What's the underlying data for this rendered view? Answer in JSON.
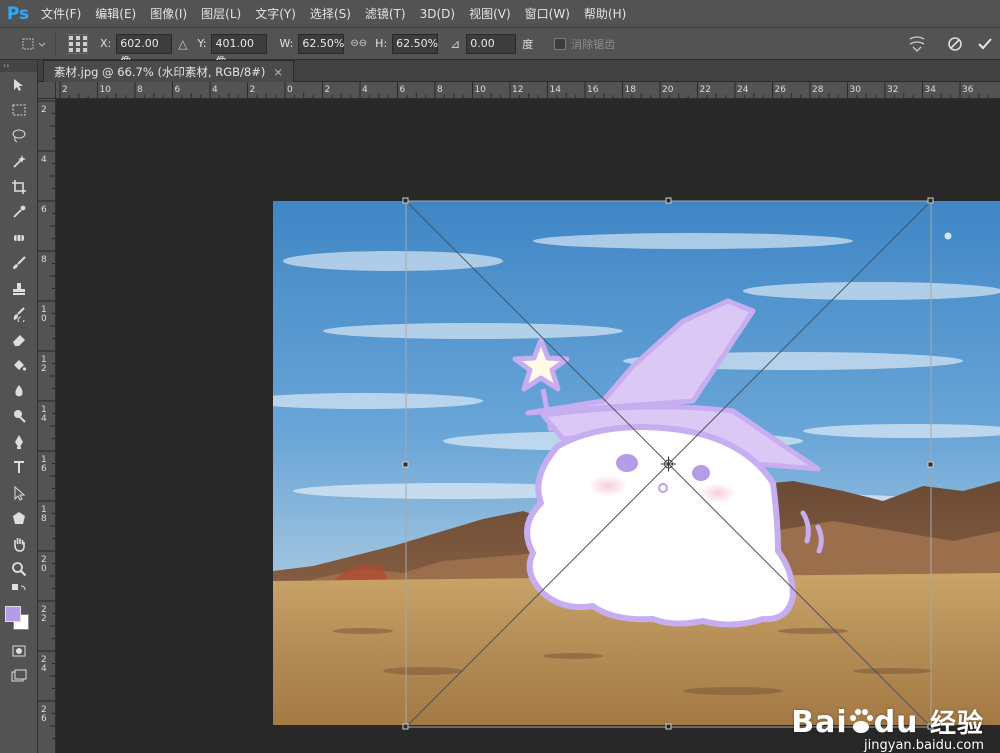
{
  "app": {
    "logo": "Ps",
    "menu": [
      "文件(F)",
      "编辑(E)",
      "图像(I)",
      "图层(L)",
      "文字(Y)",
      "选择(S)",
      "滤镜(T)",
      "3D(D)",
      "视图(V)",
      "窗口(W)",
      "帮助(H)"
    ]
  },
  "options": {
    "x_label": "X:",
    "x_value": "602.00 像",
    "y_label": "Y:",
    "y_value": "401.00 像",
    "w_label": "W:",
    "w_value": "62.50%",
    "h_label": "H:",
    "h_value": "62.50%",
    "angle_value": "0.00",
    "angle_unit": "度",
    "antialias_label": "消除锯齿",
    "delta_symbol": "△",
    "link_symbol": "⊖⊖",
    "angle_symbol": "⊿"
  },
  "document": {
    "tab_title": "素材.jpg @ 66.7% (水印素材, RGB/8#)",
    "tab_close": "×"
  },
  "rulers": {
    "horizontal_ticks": [
      "2",
      "10",
      "8",
      "6",
      "4",
      "2",
      "0",
      "2",
      "4",
      "6",
      "8",
      "10",
      "12",
      "14",
      "16",
      "18",
      "20",
      "22",
      "24",
      "26",
      "28",
      "30",
      "32",
      "34",
      "36"
    ],
    "vertical_ticks": [
      "2",
      "4",
      "6",
      "8",
      "10",
      "12",
      "14",
      "16",
      "18",
      "20",
      "22",
      "24",
      "26"
    ]
  },
  "tools": [
    "move-tool",
    "marquee-tool",
    "lasso-tool",
    "magic-wand-tool",
    "crop-tool",
    "eyedropper-tool",
    "spot-healing-tool",
    "brush-tool",
    "clone-stamp-tool",
    "history-brush-tool",
    "eraser-tool",
    "paint-bucket-tool",
    "blur-tool",
    "dodge-tool",
    "pen-tool",
    "type-tool",
    "path-selection-tool",
    "shape-tool",
    "hand-tool",
    "zoom-tool"
  ],
  "colors": {
    "foreground": "#b49ce6",
    "background": "#ffffff",
    "ps_blue": "#31a8ff"
  },
  "watermark": {
    "brand": "Bai",
    "brand_tail": "du",
    "cn": "经验",
    "url": "jingyan.baidu.com"
  }
}
